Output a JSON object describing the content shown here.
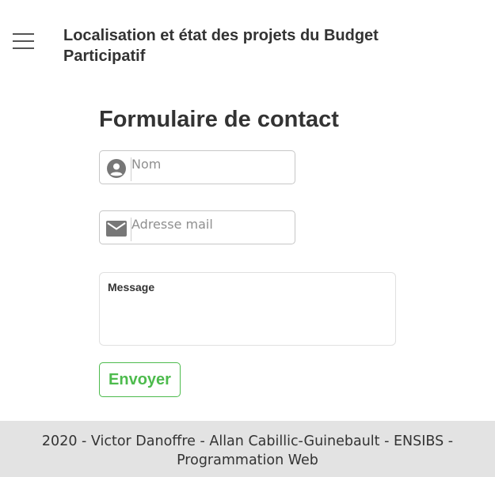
{
  "header": {
    "menu_icon": "hamburger-menu-icon",
    "title_line1": "Localisation et état des projets du Budget",
    "title_line2": "Participatif"
  },
  "form": {
    "title": "Formulaire de contact",
    "name_field": {
      "icon": "user-icon",
      "placeholder": "Nom",
      "value": ""
    },
    "email_field": {
      "icon": "mail-icon",
      "placeholder": "Adresse mail",
      "value": ""
    },
    "message": {
      "label": "Message",
      "value": ""
    },
    "submit_label": "Envoyer"
  },
  "footer": {
    "line1": "2020 - Victor Danoffre - Allan Cabillic-Guinebault - ENSIBS -",
    "line2": "Programmation Web"
  },
  "colors": {
    "accent_green": "#4dbb4d",
    "text_dark": "#333333",
    "footer_bg": "#e3e3e3",
    "icon_gray": "#777777"
  }
}
